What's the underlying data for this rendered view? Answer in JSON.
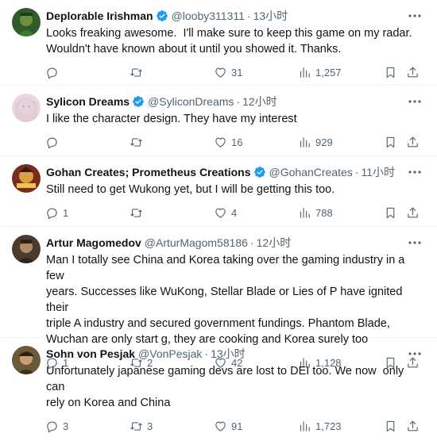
{
  "colors": {
    "verified": "#1d9bf0",
    "text": "#0f1419",
    "secondary": "#536471"
  },
  "tweets": [
    {
      "name": "Deplorable Irishman",
      "handle": "@looby311311",
      "time": "13小时",
      "text": "Looks freaking awesome.  I'll make sure to keep this game on my radar.\nWouldn't have known about it until you showed it. Thanks.",
      "replies": "",
      "retweets": "",
      "likes": "31",
      "views": "1,257"
    },
    {
      "name": "Sylicon Dreams",
      "handle": "@SyliconDreams",
      "time": "12小时",
      "text": "I like the character design. They have my interest",
      "replies": "",
      "retweets": "",
      "likes": "16",
      "views": "929"
    },
    {
      "name": "Gohan Creates; Prometheus Creations",
      "handle": "@GohanCreates",
      "time": "11小时",
      "text": "Still need to get Wukong yet, but I will be getting this too.",
      "replies": "1",
      "retweets": "",
      "likes": "4",
      "views": "788"
    },
    {
      "name": "Artur Magomedov",
      "handle": "@ArturMagom58186",
      "time": "12小时",
      "text": "Man I totally see China and Korea taking over the gaming industry in a few\nyears. Successes like WuKong, Stellar Blade or Lies of P have ignited their\ntriple A industry and secured government fundings. Phantom Blade,\nWuchan are only start g, they are cooking and Korea surely too",
      "replies": "1",
      "retweets": "2",
      "likes": "42",
      "views": "1,128"
    },
    {
      "name": "Sohn von Pesjak",
      "handle": "@VonPesjak",
      "time": "13小时",
      "text": "Unfortunately japanese gaming devs are lost to DEI too. We now  only can\nrely on Korea and China",
      "replies": "3",
      "retweets": "3",
      "likes": "91",
      "views": "1,723"
    }
  ]
}
